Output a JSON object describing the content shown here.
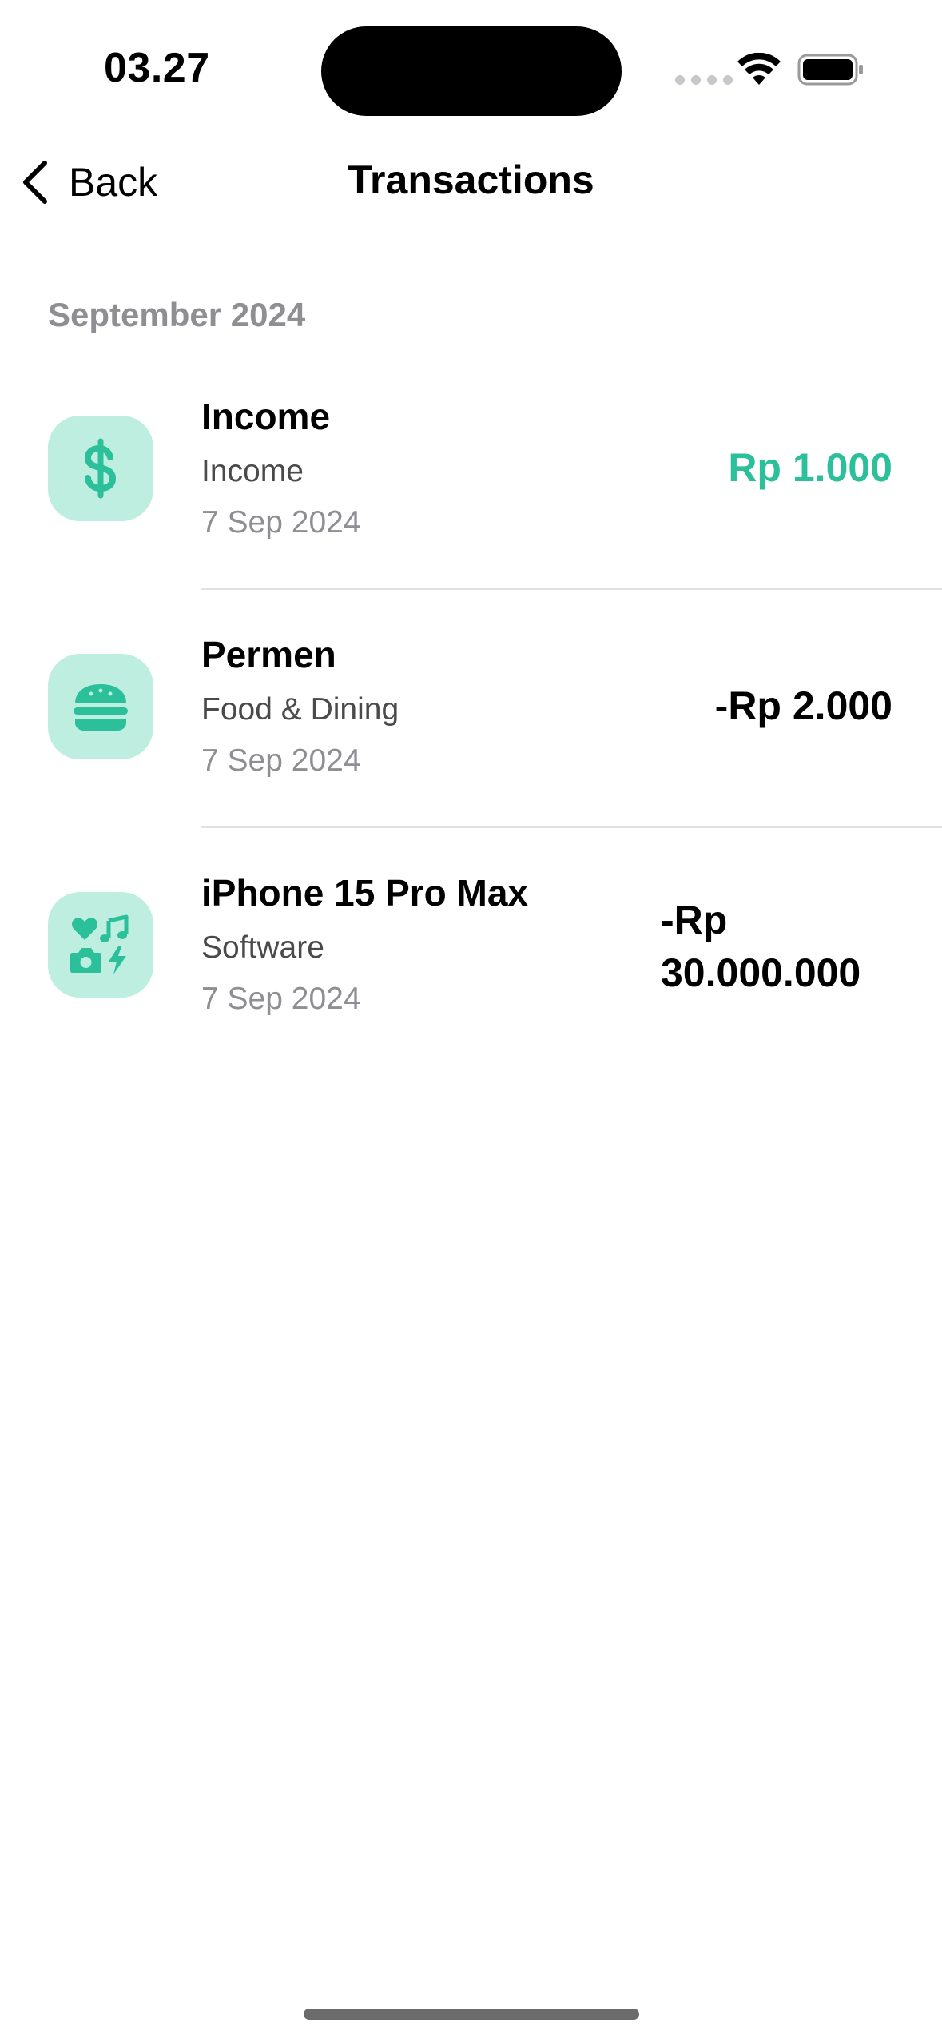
{
  "status_bar": {
    "time": "03.27"
  },
  "nav": {
    "back_label": "Back",
    "title": "Transactions"
  },
  "section": {
    "header": "September 2024"
  },
  "transactions": [
    {
      "title": "Income",
      "category": "Income",
      "date": "7 Sep 2024",
      "amount": "Rp 1.000",
      "icon": "dollar-sign-icon",
      "type": "income"
    },
    {
      "title": "Permen",
      "category": "Food & Dining",
      "date": "7 Sep 2024",
      "amount": "-Rp 2.000",
      "icon": "burger-icon",
      "type": "expense"
    },
    {
      "title": "iPhone 15 Pro Max",
      "category": "Software",
      "date": "7 Sep 2024",
      "amount": "-Rp 30.000.000",
      "icon": "entertainment-icon",
      "type": "expense"
    }
  ],
  "colors": {
    "accent": "#2bbf9a",
    "icon_background": "#bdeee0",
    "icon_foreground": "#2bbf9a",
    "secondary_text": "#8e8e93"
  }
}
